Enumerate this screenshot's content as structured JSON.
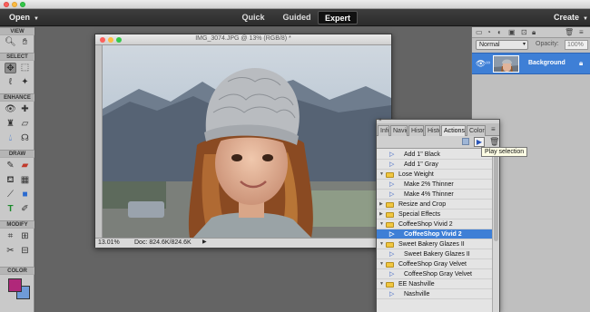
{
  "menubar": {
    "open_label": "Open",
    "create_label": "Create"
  },
  "modes": [
    {
      "label": "Quick",
      "active": false
    },
    {
      "label": "Guided",
      "active": false
    },
    {
      "label": "Expert",
      "active": true
    }
  ],
  "toolbox": {
    "sections": [
      "VIEW",
      "SELECT",
      "ENHANCE",
      "DRAW",
      "MODIFY",
      "COLOR"
    ],
    "foreground_color": "#b0287a",
    "background_color": "#6f9bd8"
  },
  "document": {
    "title": "IMG_3074.JPG @ 13% (RGB/8) *",
    "zoom": "13.01%",
    "doc_info": "Doc: 824.6K/824.6K"
  },
  "layers": {
    "blend_mode": "Normal",
    "opacity_label": "Opacity:",
    "opacity_value": "100%",
    "layer_name": "Background"
  },
  "actions_panel": {
    "tabs": [
      "Info",
      "Navig",
      "Histo",
      "Histo",
      "Actions",
      "Color"
    ],
    "active_tab": "Actions",
    "tooltip": "Play selection",
    "rows": [
      {
        "type": "action",
        "label": "Add 1\" Black",
        "indent": 1
      },
      {
        "type": "action",
        "label": "Add 1\" Gray",
        "indent": 1
      },
      {
        "type": "set",
        "label": "Lose Weight",
        "expanded": true
      },
      {
        "type": "action",
        "label": "Make 2% Thinner",
        "indent": 1
      },
      {
        "type": "action",
        "label": "Make 4% Thinner",
        "indent": 1
      },
      {
        "type": "set",
        "label": "Resize and Crop",
        "expanded": false
      },
      {
        "type": "set",
        "label": "Special Effects",
        "expanded": false
      },
      {
        "type": "set",
        "label": "CoffeeShop Vivid 2",
        "expanded": true
      },
      {
        "type": "action",
        "label": "CoffeeShop Vivid 2",
        "indent": 1,
        "selected": true
      },
      {
        "type": "set",
        "label": "Sweet Bakery Glazes II",
        "expanded": true
      },
      {
        "type": "action",
        "label": "Sweet Bakery Glazes II",
        "indent": 1
      },
      {
        "type": "set",
        "label": "CoffeeShop Gray Velvet",
        "expanded": true
      },
      {
        "type": "action",
        "label": "CoffeeShop Gray Velvet",
        "indent": 1
      },
      {
        "type": "set",
        "label": "EE Nashville",
        "expanded": true
      },
      {
        "type": "action",
        "label": "Nashville",
        "indent": 1
      }
    ]
  }
}
